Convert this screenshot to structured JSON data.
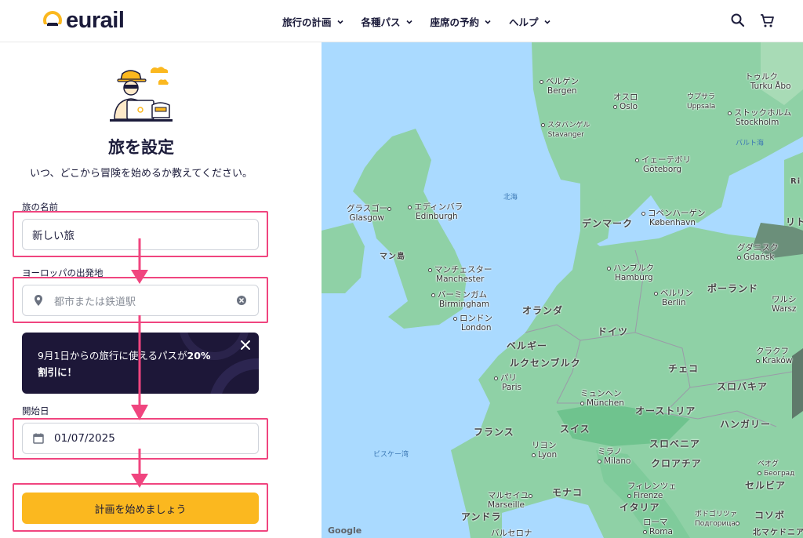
{
  "header": {
    "logo_text": "eurail",
    "nav": [
      {
        "label": "旅行の計画"
      },
      {
        "label": "各種パス"
      },
      {
        "label": "座席の予約"
      },
      {
        "label": "ヘルプ"
      }
    ]
  },
  "panel": {
    "title": "旅を設定",
    "subtitle": "いつ、どこから冒険を始めるか教えてください。",
    "trip_name": {
      "label": "旅の名前",
      "value": "新しい旅"
    },
    "origin": {
      "label": "ヨーロッパの出発地",
      "placeholder": "都市または鉄道駅"
    },
    "promo": {
      "text_before": "9月1日からの旅行に使えるパスが",
      "text_bold": "20%",
      "text_after": "割引に！"
    },
    "start_date": {
      "label": "開始日",
      "value": "01/07/2025"
    },
    "cta_label": "計画を始めましょう"
  },
  "colors": {
    "accent": "#fbb81f",
    "highlight": "#f0457f",
    "promo_bg": "#1d1738",
    "brand": "#1b1b3a"
  },
  "map": {
    "cities": [
      {
        "ja": "ベルゲン",
        "en": "Bergen"
      },
      {
        "ja": "オスロ",
        "en": "Oslo"
      },
      {
        "ja": "ウプサラ",
        "en": "Uppsala"
      },
      {
        "ja": "ストックホルム",
        "en": "Stockholm"
      },
      {
        "ja": "トゥルク",
        "en": "Turku Åbo"
      },
      {
        "ja": "スタバンゲル",
        "en": "Stavanger"
      },
      {
        "ja": "イェーテボリ",
        "en": "Göteborg"
      },
      {
        "ja": "グラスゴー",
        "en": "Glasgow"
      },
      {
        "ja": "エディンバラ",
        "en": "Edinburgh"
      },
      {
        "ja": "コペンハーゲン",
        "en": "København"
      },
      {
        "ja": "グダニスク",
        "en": "Gdańsk"
      },
      {
        "ja": "マンチェスター",
        "en": "Manchester"
      },
      {
        "ja": "ハンブルク",
        "en": "Hamburg"
      },
      {
        "ja": "バーミンガム",
        "en": "Birmingham"
      },
      {
        "ja": "ベルリン",
        "en": "Berlin"
      },
      {
        "ja": "ワルシ",
        "en": "Warsz"
      },
      {
        "ja": "ロンドン",
        "en": "London"
      },
      {
        "ja": "クラクフ",
        "en": "Kraków"
      },
      {
        "ja": "パリ",
        "en": "Paris"
      },
      {
        "ja": "ミュンヘン",
        "en": "München"
      },
      {
        "ja": "リヨン",
        "en": "Lyon"
      },
      {
        "ja": "ミラノ",
        "en": "Milano"
      },
      {
        "ja": "フィレンツェ",
        "en": "Firenze"
      },
      {
        "ja": "マルセイユ",
        "en": "Marseille"
      },
      {
        "ja": "ローマ",
        "en": "Roma"
      },
      {
        "ja": "ベオグ",
        "en": "Београд"
      },
      {
        "ja": "ポドゴリツァ",
        "en": "Подгорица"
      },
      {
        "ja": "バルセロナ",
        "en": ""
      }
    ],
    "countries": [
      "デンマーク",
      "マン島",
      "オランダ",
      "ドイツ",
      "ポーランド",
      "ベルギー",
      "ルクセンブルク",
      "チェコ",
      "スロバキア",
      "オーストリア",
      "フランス",
      "スイス",
      "ハンガリー",
      "スロベニア",
      "クロアチア",
      "モナコ",
      "イタリア",
      "セルビア",
      "アンドラ",
      "コソボ",
      "北マケドニア",
      "リト",
      "Ri"
    ],
    "seas": [
      "北海",
      "バルト海",
      "ビスケー湾"
    ],
    "google": "Google"
  }
}
